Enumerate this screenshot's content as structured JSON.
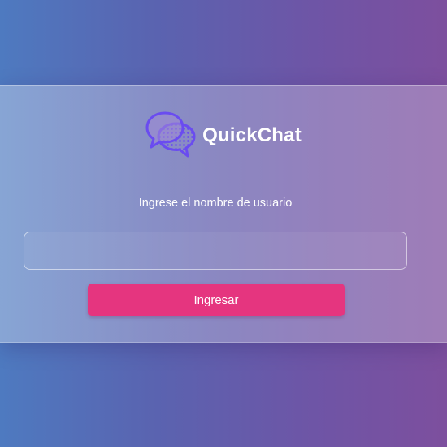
{
  "app": {
    "name": "QuickChat",
    "logo_icon": "chat-bubbles-icon"
  },
  "login": {
    "prompt": "Ingrese el nombre de usuario",
    "username_value": "",
    "username_placeholder": "",
    "submit_label": "Ingresar"
  },
  "colors": {
    "background_left": "#4e7ac0",
    "background_right": "#7d4f9e",
    "logo_purple": "#6a4cf0",
    "button": "#e5357f",
    "text": "#ffffff"
  }
}
